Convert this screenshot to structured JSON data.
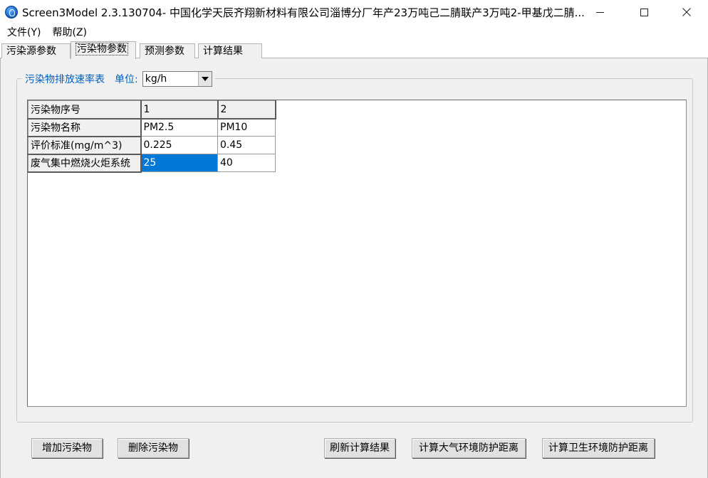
{
  "window": {
    "title": "Screen3Model 2.3.130704- 中国化学天辰齐翔新材料有限公司淄博分厂年产23万吨己二腈联产3万吨2-甲基戊二腈...",
    "icon": "app-globe-icon"
  },
  "menu": {
    "items": [
      "文件(Y)",
      "帮助(Z)"
    ]
  },
  "tabs": [
    {
      "label": "污染源参数",
      "active": false
    },
    {
      "label": "污染物参数",
      "active": true
    },
    {
      "label": "预测参数",
      "active": false
    },
    {
      "label": "计算结果",
      "active": false
    }
  ],
  "group": {
    "title": "污染物排放速率表",
    "unit_label": "单位:",
    "unit_value": "kg/h"
  },
  "grid": {
    "row_headers": [
      "污染物序号",
      "污染物名称",
      "评价标准(mg/m^3)",
      "废气集中燃烧火炬系统"
    ],
    "columns": [
      {
        "values": [
          "1",
          "PM2.5",
          "0.225",
          "25"
        ]
      },
      {
        "values": [
          "2",
          "PM10",
          "0.45",
          "40"
        ]
      }
    ],
    "selected_cell": "row4-col1",
    "selection_color": "#0078d7"
  },
  "buttons": {
    "add": "增加污染物",
    "delete": "删除污染物",
    "refresh": "刷新计算结果",
    "calc_atmo": "计算大气环境防护距离",
    "calc_health": "计算卫生环境防护距离"
  }
}
